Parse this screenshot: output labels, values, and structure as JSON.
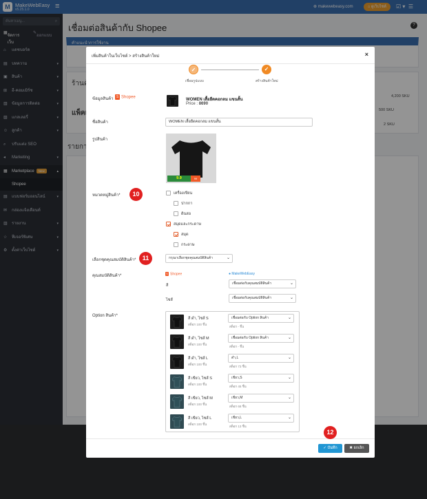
{
  "topbar": {
    "brand": "MakeWebEasy",
    "version": "v5.25.1.0",
    "site": "makewebeasy.com",
    "buyer_label": "ดูเว็บไซต์",
    "menu_icon": "hamburger-icon"
  },
  "sidebar": {
    "search_placeholder": "ค้นหาเมนู...",
    "tab_manage": "จัดการเว็บ",
    "tab_design": "ออกแบบ",
    "items": [
      {
        "label": "แดชบอร์ด",
        "icon": "home-icon"
      },
      {
        "label": "บทความ",
        "icon": "doc-icon"
      },
      {
        "label": "สินค้า",
        "icon": "box-icon"
      },
      {
        "label": "อี-คอมเมิร์ซ",
        "icon": "cart-icon"
      },
      {
        "label": "ข้อมูลการติดต่อ",
        "icon": "contact-icon"
      },
      {
        "label": "แกลเลอรี่",
        "icon": "gallery-icon"
      },
      {
        "label": "ลูกค้า",
        "icon": "users-icon"
      },
      {
        "label": "ปรับแต่ง SEO",
        "icon": "search-icon"
      },
      {
        "label": "Marketing",
        "icon": "megaphone-icon"
      },
      {
        "label": "Marketplace",
        "icon": "store-icon",
        "badge": "New"
      },
      {
        "label": "แบบฟอร์มออนไลน์",
        "icon": "form-icon"
      },
      {
        "label": "กล่องแจ้งเตือนท์",
        "icon": "inbox-icon"
      },
      {
        "label": "รายงาน",
        "icon": "chart-icon"
      },
      {
        "label": "ฟีเจอร์พิเศษ",
        "icon": "star-icon"
      },
      {
        "label": "ตั้งค่าเว็บไซต์",
        "icon": "gear-icon"
      }
    ],
    "sub_active": "Shopee"
  },
  "page": {
    "title": "เชื่อมต่อสินค้ากับ Shopee",
    "bg_panel_title": "คำแนะนำการใช้งาน",
    "bg_label_store": "ร้านค้า",
    "bg_label_package": "แพ็คเ",
    "bg_label_list": "รายกา",
    "bg_sku1": "4,200 SKU",
    "bg_sku2": "500 SKU",
    "bg_sku3": "2 SKU"
  },
  "modal": {
    "breadcrumb": "เพิ่มสินค้าในเว็บไซต์ > สร้างสินค้าใหม่",
    "close": "×",
    "steps": [
      {
        "label": "เชื่อมรูปแบบ",
        "icon": "check-icon"
      },
      {
        "label": "สร้างสินค้าใหม่",
        "icon": "check-icon"
      }
    ],
    "label_product_info": "ข้อมูลสินค้า",
    "shopee": "Shopee",
    "product_name": "WOMEN เสื้อยืดคอกลม แขนสั้น",
    "price_label": "Price :",
    "price": "8690",
    "label_name": "ชื่อสินค้า",
    "name_value": "WOMEN เสื้อยืดคอกลม แขนสั้น",
    "label_image": "รูปสินค้า",
    "image_badge": "9.9",
    "image_badge2": "99 ",
    "label_category": "หมวดหมู่สินค้า*",
    "categories": [
      {
        "label": "เครื่องเขียน",
        "checked": false
      },
      {
        "label": "ปากกา",
        "checked": false
      },
      {
        "label": "ดินสอ",
        "checked": false
      },
      {
        "label": "สมุดและกระดาษ",
        "checked": true
      },
      {
        "label": "สมุด",
        "checked": true
      },
      {
        "label": "กระดาษ",
        "checked": false
      }
    ],
    "label_attr_group": "เลือกชุดคุณสมบัติสินค้า*",
    "attr_group_value": "กรุณาเลือกชุดคุณสมบัติสินค้า",
    "label_attr": "คุณสมบัติสินค้า*",
    "attr_col_shopee": "Shopee",
    "attr_col_web": "MakeWebEasy",
    "attrs": [
      {
        "name": "สี",
        "value": "เชื่อมต่อกับคุณสมบัติสินค้า"
      },
      {
        "name": "ไซส์",
        "value": "เชื่อมต่อกับคุณสมบัติสินค้า"
      }
    ],
    "label_options": "Option สินค้า*",
    "options": [
      {
        "name": "สี ดำ, ไซส์ S",
        "stock": "สต็อก 100 ชิ้น",
        "select": "เชื่อมต่อกับ Option สินค้า",
        "sub": "สต็อก - ชิ้น",
        "color": "black"
      },
      {
        "name": "สี ดำ, ไซส์ M",
        "stock": "สต็อก 100 ชิ้น",
        "select": "เชื่อมต่อกับ Option สินค้า",
        "sub": "สต็อก - ชิ้น",
        "color": "black"
      },
      {
        "name": "สี ดำ, ไซส์ L",
        "stock": "สต็อก 100 ชิ้น",
        "select": "ดำ,L",
        "sub": "สต็อก 73 ชิ้น",
        "color": "black"
      },
      {
        "name": "สี เขียว, ไซส์ S",
        "stock": "สต็อก 100 ชิ้น",
        "select": "เขียว,S",
        "sub": "สต็อก 45 ชิ้น",
        "color": "teal"
      },
      {
        "name": "สี เขียว, ไซส์ M",
        "stock": "สต็อก 100 ชิ้น",
        "select": "เขียว,M",
        "sub": "สต็อก 68 ชิ้น",
        "color": "teal"
      },
      {
        "name": "สี เขียว, ไซส์ L",
        "stock": "สต็อก 100 ชิ้น",
        "select": "เขียว,L",
        "sub": "สต็อก 13 ชิ้น",
        "color": "teal"
      }
    ],
    "save_label": "บันทึก",
    "cancel_label": "ยกเลิก"
  },
  "callouts": [
    "10",
    "11",
    "12"
  ],
  "colors": {
    "topbar": "#3a6fb0",
    "accent": "#f08a24",
    "callout": "#e12020",
    "save": "#2196d3"
  }
}
